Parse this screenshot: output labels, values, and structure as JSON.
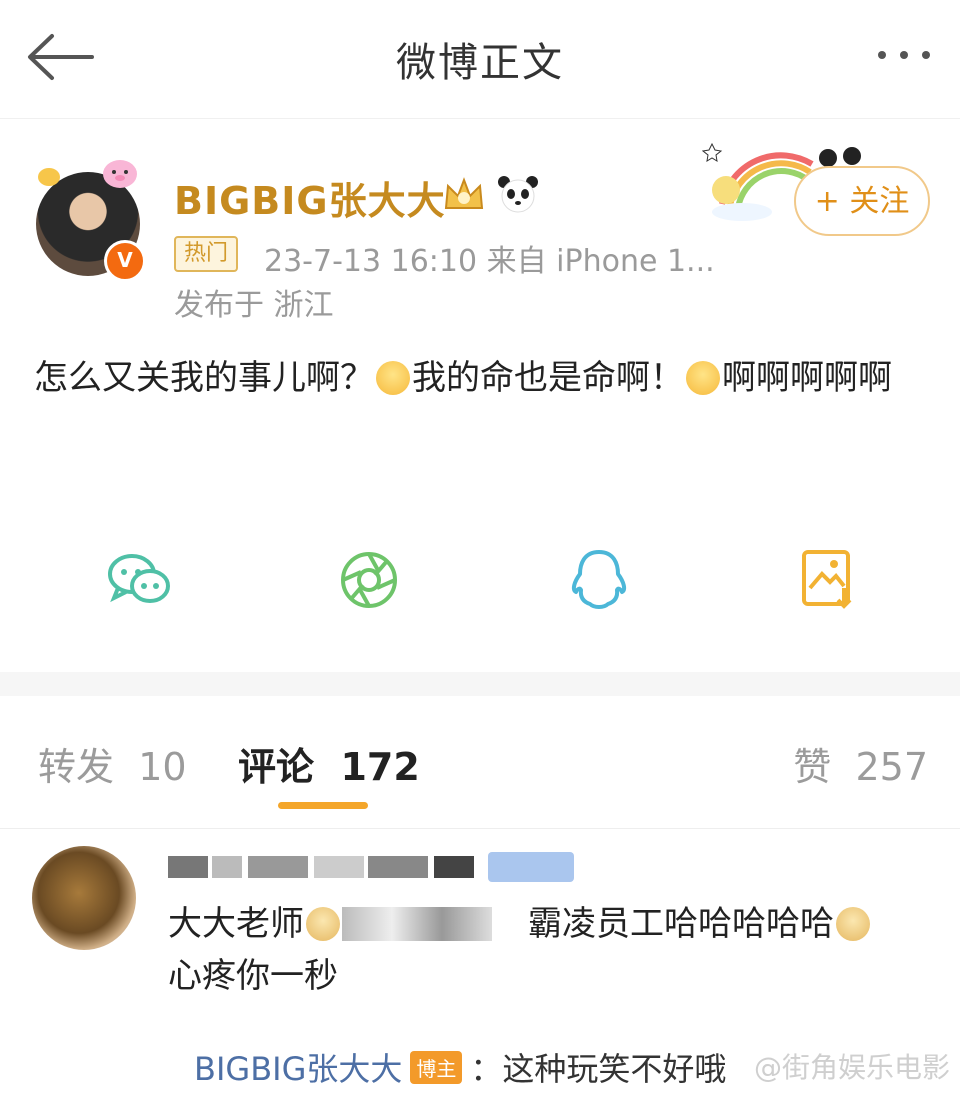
{
  "header": {
    "title": "微博正文"
  },
  "post": {
    "username": "BIGBIG张大大",
    "hot_tag": "热门",
    "meta": "23-7-13  16:10  来自  iPhone 1...",
    "location": "发布于  浙江",
    "follow_label": "+ 关注",
    "text_part1": "怎么又关我的事儿啊？",
    "text_part2": "我的命也是命啊！",
    "text_part3": "啊啊啊啊啊"
  },
  "share": {
    "colors": {
      "wechat": "#4fc0a6",
      "moments": "#6ec46a",
      "qq": "#4cb7d8",
      "save": "#f2b233"
    }
  },
  "tabs": {
    "repost_label": "转发",
    "repost_count": "10",
    "comment_label": "评论",
    "comment_count": "172",
    "like_label": "赞",
    "like_count": "257"
  },
  "comment": {
    "text_part1": "大大老师",
    "text_part2": "霸凌员工哈哈哈哈哈",
    "text_part3": "心疼你一秒",
    "reply_name": "BIGBIG张大大",
    "reply_badge": "博主",
    "reply_text": "：这种玩笑不好哦"
  },
  "watermark": "@街角娱乐电影",
  "colors": {
    "accent": "#f4a62a",
    "username": "#c58a1f",
    "link": "#4d6fa5"
  }
}
